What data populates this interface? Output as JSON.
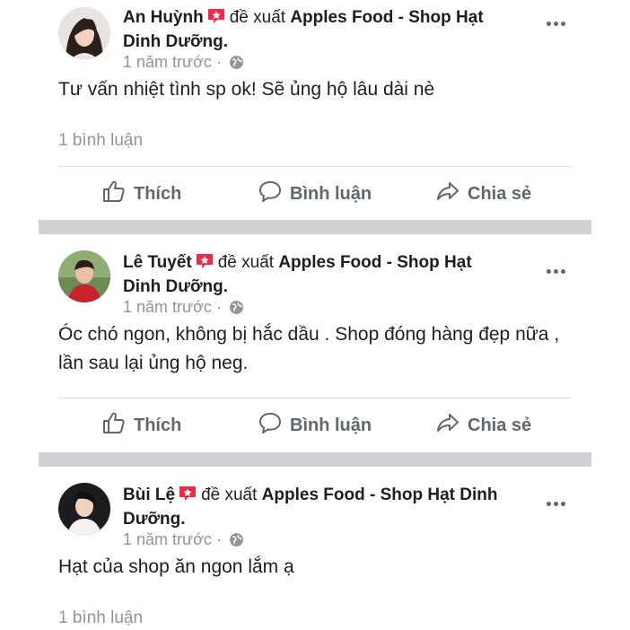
{
  "posts": [
    {
      "author": "An Huỳnh",
      "verb": "đề xuất",
      "page": "Apples Food - Shop Hạt Dinh Dưỡng.",
      "time": "1 năm trước",
      "content": "Tư vấn nhiệt tình sp ok! Sẽ ủng hộ lâu dài nè",
      "comment_count": "1 bình luận",
      "actions": {
        "like": "Thích",
        "comment": "Bình luận",
        "share": "Chia sẻ"
      }
    },
    {
      "author": "Lê Tuyết",
      "verb": "đề xuất",
      "page": "Apples Food - Shop Hạt Dinh Dưỡng.",
      "time": "1 năm trước",
      "content": "Óc chó ngon, không bị hắc dầu . Shop đóng hàng đẹp nữa , lần sau lại ủng hộ neg.",
      "actions": {
        "like": "Thích",
        "comment": "Bình luận",
        "share": "Chia sẻ"
      }
    },
    {
      "author": "Bùi Lệ",
      "verb": "đề xuất",
      "page": "Apples Food - Shop Hạt Dinh Dưỡng.",
      "time": "1 năm trước",
      "content": "Hạt của shop ăn ngon lắm ạ",
      "comment_count": "1 bình luận"
    }
  ],
  "icons": {
    "recommend": "recommend-badge-icon",
    "more": "more-options-icon",
    "globe": "public-globe-icon",
    "like": "thumbs-up-icon",
    "comment": "comment-bubble-icon",
    "share": "share-arrow-icon"
  },
  "colors": {
    "recommend_badge": "#f02849",
    "muted_text": "#90949c",
    "separator": "#cfd1d5"
  }
}
